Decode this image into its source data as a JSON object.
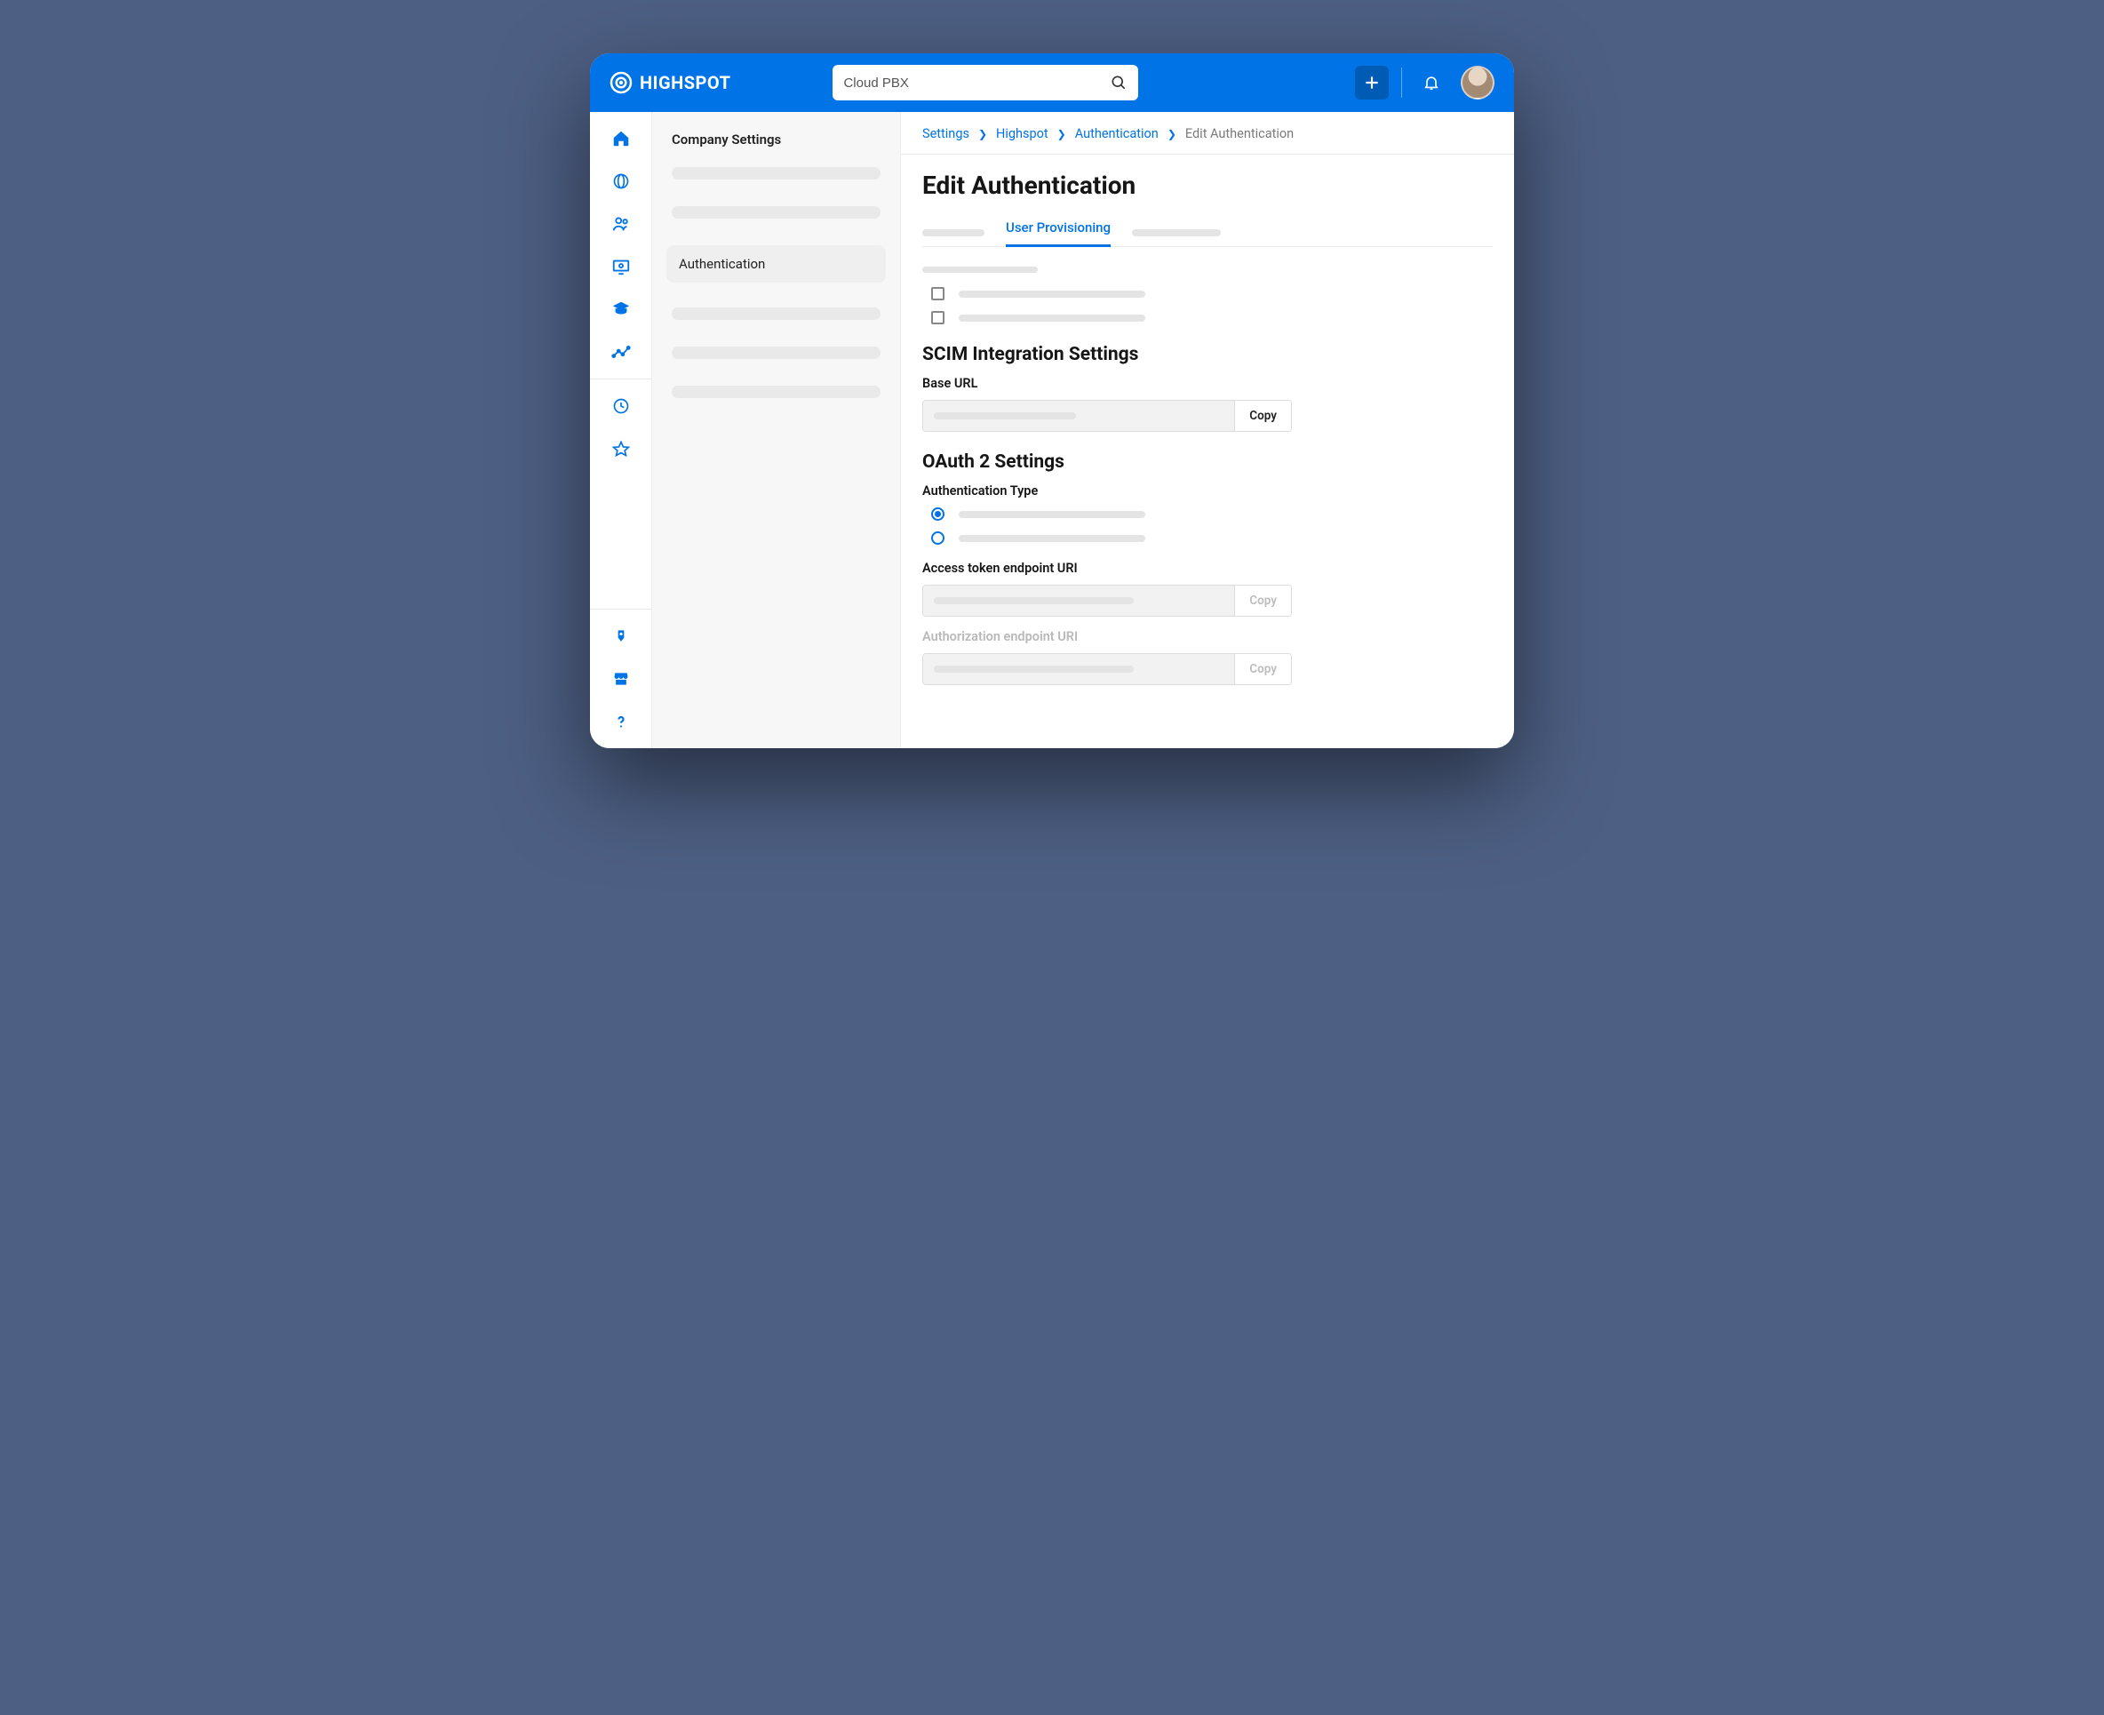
{
  "brand": "HIGHSPOT",
  "search": {
    "value": "Cloud PBX"
  },
  "subnav": {
    "title": "Company Settings",
    "active_item": "Authentication"
  },
  "breadcrumbs": {
    "items": [
      "Settings",
      "Highspot",
      "Authentication"
    ],
    "current": "Edit Authentication"
  },
  "page": {
    "title": "Edit Authentication",
    "active_tab": "User Provisioning",
    "section_scim": "SCIM Integration Settings",
    "label_base_url": "Base URL",
    "section_oauth": "OAuth 2 Settings",
    "label_auth_type": "Authentication Type",
    "label_token_uri": "Access token endpoint URI",
    "label_authz_uri": "Authorization endpoint URI",
    "copy_label": "Copy"
  }
}
